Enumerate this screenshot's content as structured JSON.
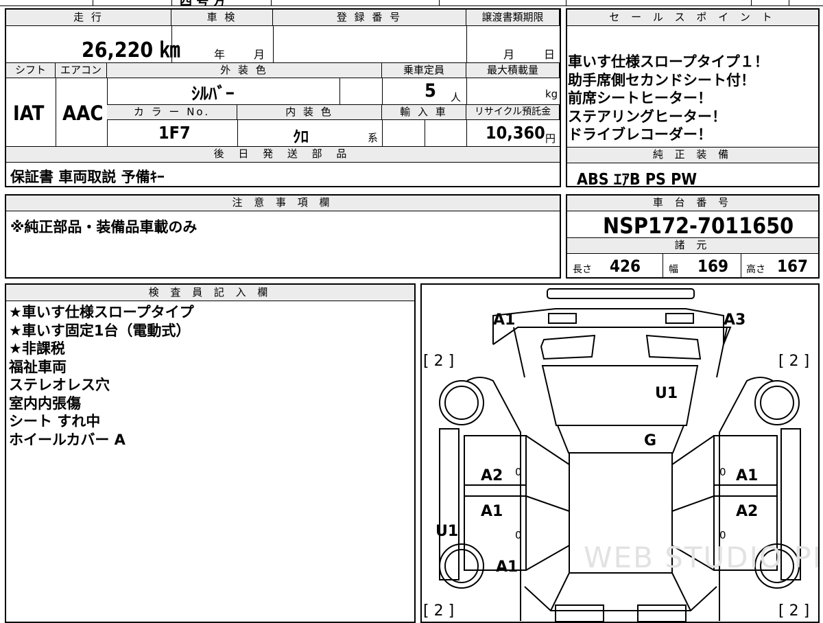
{
  "top_partial": "四 号 方",
  "spec": {
    "mileage_label": "走 行",
    "mileage": "26,220 ㎞",
    "inspection_label": "車 検",
    "inspection_year": "年",
    "inspection_month": "月",
    "registration_label": "登 録 番 号",
    "transfer_label": "譲渡書類期限",
    "transfer_month": "月",
    "transfer_day": "日",
    "shift_label": "シフト",
    "shift": "IAT",
    "ac_label": "エアコン",
    "ac": "AAC",
    "exterior_label": "外 装 色",
    "exterior": "ｼﾙﾊﾞｰ",
    "capacity_label": "乗車定員",
    "capacity": "5",
    "capacity_unit": "人",
    "maxload_label": "最大積載量",
    "maxload_unit": "kg",
    "color_no_label": "カ ラ ー No.",
    "color_no": "1F7",
    "interior_label": "内 装 色",
    "interior": "ｸﾛ",
    "interior_suffix": "系",
    "import_label": "輸 入 車",
    "recycle_label": "リサイクル預託金",
    "recycle": "10,360",
    "recycle_unit": "円",
    "later_parts_label": "後 日 発 送 部 品",
    "later_parts": "保証書 車両取説 予備ｷｰ"
  },
  "sales": {
    "label": "セ ー ル ス ポ イ ン ト",
    "lines": [
      "車いす仕様スロープタイプ１！",
      "助手席側セカンドシート付！",
      "前席シートヒーター！",
      "ステアリングヒーター！",
      "ドライブレコーダー！"
    ],
    "equipment_label": "純 正 装 備",
    "equipment": "ABS ｴｱB PS PW"
  },
  "notes": {
    "label": "注 意 事 項 欄",
    "text": "※純正部品・装備品車載のみ"
  },
  "chassis": {
    "label": "車 台 番 号",
    "number": "NSP172-7011650",
    "dims_label": "諸 元",
    "length_label": "長さ",
    "length": "426",
    "width_label": "幅",
    "width": "169",
    "height_label": "高さ",
    "height": "167"
  },
  "inspector": {
    "label": "検 査 員 記 入 欄",
    "lines": [
      "★車いす仕様スロープタイプ",
      "★車いす固定1台（電動式）",
      "★非課税",
      "福祉車両",
      "ステレオレス穴",
      "室内内張傷",
      "シート すれ中",
      "ホイールカバー A"
    ]
  },
  "diagram": {
    "marks": {
      "front_left": "A1",
      "front_right": "A3",
      "roof": "U1",
      "windshield": "G",
      "rear_left_door": "A2",
      "right_front_door": "A1",
      "left_lower": "A1",
      "right_lower": "A2",
      "left_rocker": "U1",
      "left_rear": "A1"
    },
    "tires": {
      "tl": "[ 2 ]",
      "tr": "[ 2 ]",
      "bl": "[ 2 ]",
      "br": "[ 2 ]"
    },
    "zeros": [
      "0",
      "0",
      "0",
      "0"
    ],
    "watermark": "WEB STUDIO PRO"
  }
}
